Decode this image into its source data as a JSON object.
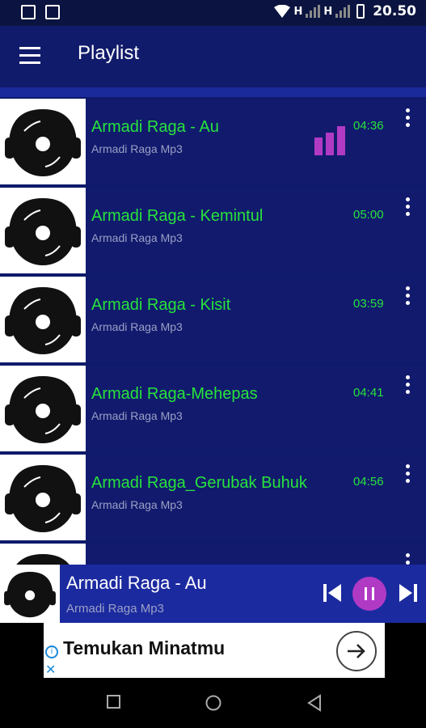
{
  "status_bar": {
    "network_1": "H",
    "network_2": "H",
    "time": "20.50"
  },
  "app_bar": {
    "title": "Playlist"
  },
  "playlist": [
    {
      "title": "Armadi Raga - Au",
      "artist": "Armadi Raga Mp3",
      "duration": "04:36",
      "playing": true
    },
    {
      "title": "Armadi Raga - Kemintul",
      "artist": "Armadi Raga Mp3",
      "duration": "05:00",
      "playing": false
    },
    {
      "title": "Armadi Raga - Kisit",
      "artist": "Armadi Raga Mp3",
      "duration": "03:59",
      "playing": false
    },
    {
      "title": "Armadi Raga-Mehepas",
      "artist": "Armadi Raga Mp3",
      "duration": "04:41",
      "playing": false
    },
    {
      "title": "Armadi Raga_Gerubak Buhuk",
      "artist": "Armadi Raga Mp3",
      "duration": "04:56",
      "playing": false
    }
  ],
  "now_playing": {
    "title": "Armadi Raga - Au",
    "artist": "Armadi Raga Mp3"
  },
  "ad": {
    "text": "Temukan Minatmu"
  },
  "colors": {
    "accent_green": "#27e33b",
    "accent_purple": "#b13ac4",
    "bar_blue": "#111b6b"
  }
}
